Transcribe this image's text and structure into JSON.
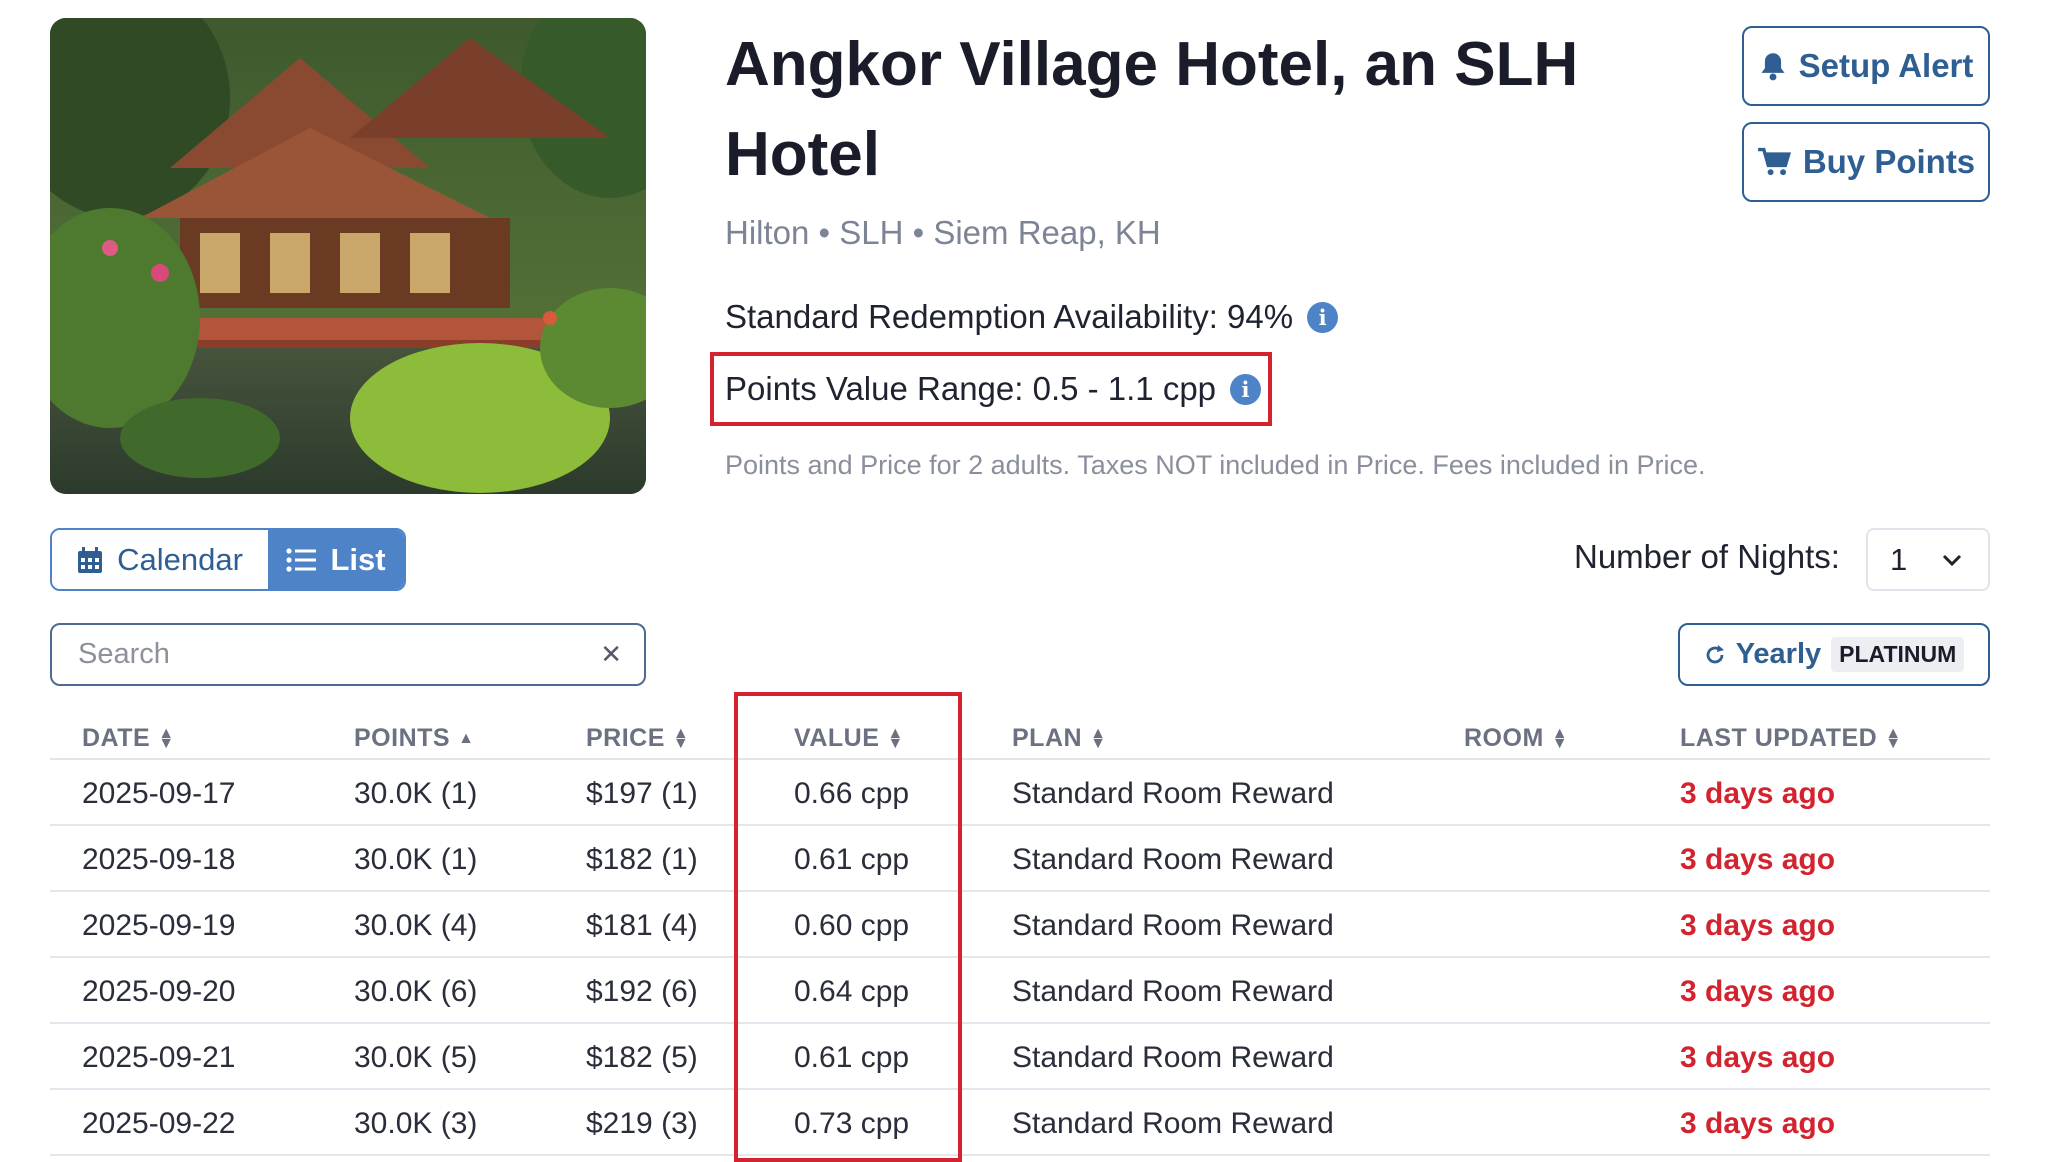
{
  "hotel": {
    "name": "Angkor Village Hotel, an SLH Hotel",
    "subtitle": "Hilton • SLH • Siem Reap, KH",
    "availability": "Standard Redemption Availability: 94%",
    "points_value_range": "Points Value Range: 0.5 - 1.1 cpp",
    "note": "Points and Price for 2 adults.  Taxes NOT included in Price. Fees included in Price."
  },
  "actions": {
    "setup_alert": "Setup Alert",
    "buy_points": "Buy Points"
  },
  "view": {
    "calendar": "Calendar",
    "list": "List",
    "active": "List"
  },
  "nights": {
    "label": "Number of Nights:",
    "value": "1"
  },
  "search": {
    "placeholder": "Search",
    "value": ""
  },
  "yearly": {
    "label": "Yearly",
    "badge": "PLATINUM"
  },
  "table": {
    "columns": [
      "DATE",
      "POINTS",
      "PRICE",
      "VALUE",
      "PLAN",
      "ROOM",
      "LAST UPDATED"
    ],
    "rows": [
      {
        "date": "2025-09-17",
        "points": "30.0K (1)",
        "price": "$197 (1)",
        "value": "0.66 cpp",
        "plan": "Standard Room Reward",
        "room": "",
        "updated": "3 days ago"
      },
      {
        "date": "2025-09-18",
        "points": "30.0K (1)",
        "price": "$182 (1)",
        "value": "0.61 cpp",
        "plan": "Standard Room Reward",
        "room": "",
        "updated": "3 days ago"
      },
      {
        "date": "2025-09-19",
        "points": "30.0K (4)",
        "price": "$181 (4)",
        "value": "0.60 cpp",
        "plan": "Standard Room Reward",
        "room": "",
        "updated": "3 days ago"
      },
      {
        "date": "2025-09-20",
        "points": "30.0K (6)",
        "price": "$192 (6)",
        "value": "0.64 cpp",
        "plan": "Standard Room Reward",
        "room": "",
        "updated": "3 days ago"
      },
      {
        "date": "2025-09-21",
        "points": "30.0K (5)",
        "price": "$182 (5)",
        "value": "0.61 cpp",
        "plan": "Standard Room Reward",
        "room": "",
        "updated": "3 days ago"
      },
      {
        "date": "2025-09-22",
        "points": "30.0K (3)",
        "price": "$219 (3)",
        "value": "0.73 cpp",
        "plan": "Standard Room Reward",
        "room": "",
        "updated": "3 days ago"
      }
    ]
  },
  "colors": {
    "accent": "#4f83c8",
    "button_border": "#2f5f92",
    "highlight_red": "#d3232f",
    "updated_red": "#d3232f"
  }
}
